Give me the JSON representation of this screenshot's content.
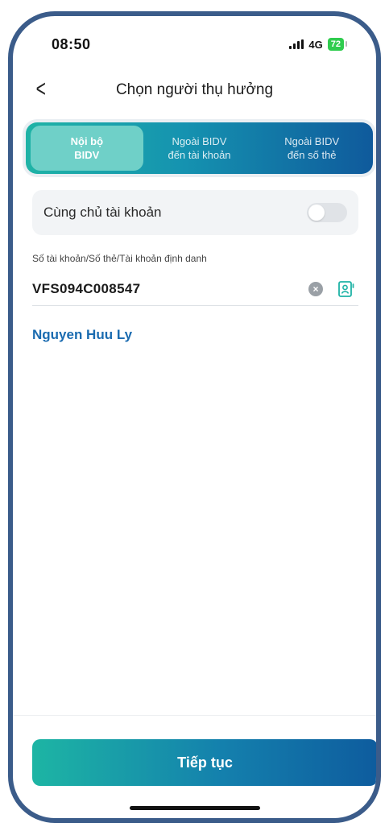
{
  "status_bar": {
    "time": "08:50",
    "network": "4G",
    "battery": "72"
  },
  "header": {
    "title": "Chọn người thụ hưởng",
    "back_icon": "chevron-left-icon"
  },
  "tabs": [
    {
      "line1": "Nội bộ",
      "line2": "BIDV",
      "active": true
    },
    {
      "line1": "Ngoài BIDV",
      "line2": "đến tài khoản",
      "active": false
    },
    {
      "line1": "Ngoài BIDV",
      "line2": "đến số thẻ",
      "active": false
    }
  ],
  "same_owner": {
    "label": "Cùng chủ tài khoản",
    "enabled": false
  },
  "account_field": {
    "label": "Số tài khoản/Số thẻ/Tài khoản định danh",
    "value": "VFS094C008547"
  },
  "payee_name": "Nguyen Huu Ly",
  "continue_button": "Tiếp tục",
  "colors": {
    "accent": "#1a6bb0",
    "teal": "#1fb3a6",
    "navy": "#0f5a9c"
  }
}
